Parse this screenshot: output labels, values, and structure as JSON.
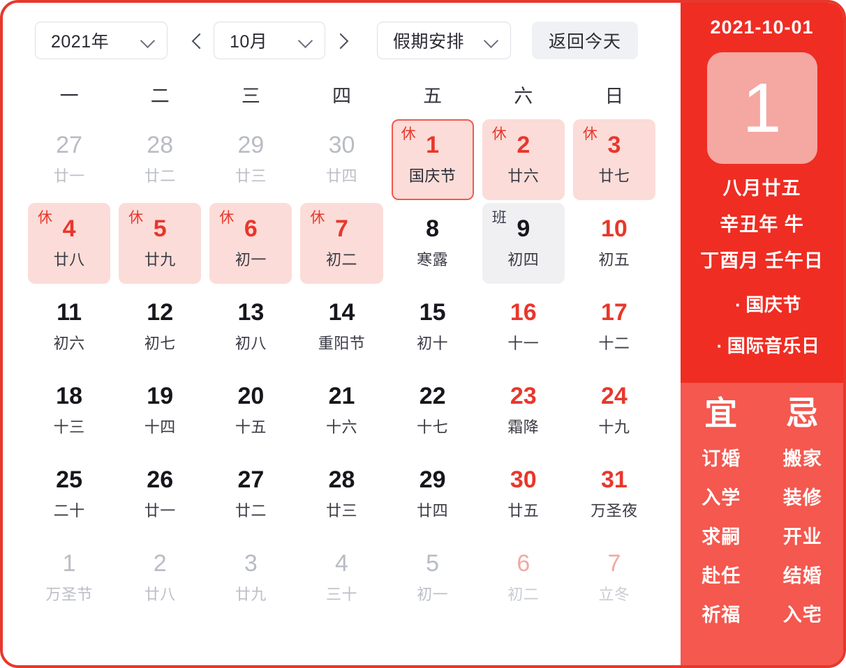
{
  "toolbar": {
    "year": "2021年",
    "month": "10月",
    "holiday_filter": "假期安排",
    "today_label": "返回今天",
    "prev_icon": "chevron-left-icon",
    "next_icon": "chevron-right-icon"
  },
  "weekdays": [
    "一",
    "二",
    "三",
    "四",
    "五",
    "六",
    "日"
  ],
  "days": [
    {
      "num": "27",
      "lunar": "廿一",
      "state": "out"
    },
    {
      "num": "28",
      "lunar": "廿二",
      "state": "out"
    },
    {
      "num": "29",
      "lunar": "廿三",
      "state": "out"
    },
    {
      "num": "30",
      "lunar": "廿四",
      "state": "out"
    },
    {
      "num": "1",
      "lunar": "国庆节",
      "state": "rest selected",
      "badge": "休"
    },
    {
      "num": "2",
      "lunar": "廿六",
      "state": "rest",
      "badge": "休"
    },
    {
      "num": "3",
      "lunar": "廿七",
      "state": "rest",
      "badge": "休"
    },
    {
      "num": "4",
      "lunar": "廿八",
      "state": "rest",
      "badge": "休"
    },
    {
      "num": "5",
      "lunar": "廿九",
      "state": "rest",
      "badge": "休"
    },
    {
      "num": "6",
      "lunar": "初一",
      "state": "rest",
      "badge": "休"
    },
    {
      "num": "7",
      "lunar": "初二",
      "state": "rest",
      "badge": "休"
    },
    {
      "num": "8",
      "lunar": "寒露",
      "state": "normal"
    },
    {
      "num": "9",
      "lunar": "初四",
      "state": "work",
      "badge": "班"
    },
    {
      "num": "10",
      "lunar": "初五",
      "state": "weekend"
    },
    {
      "num": "11",
      "lunar": "初六",
      "state": "normal"
    },
    {
      "num": "12",
      "lunar": "初七",
      "state": "normal"
    },
    {
      "num": "13",
      "lunar": "初八",
      "state": "normal"
    },
    {
      "num": "14",
      "lunar": "重阳节",
      "state": "normal"
    },
    {
      "num": "15",
      "lunar": "初十",
      "state": "normal"
    },
    {
      "num": "16",
      "lunar": "十一",
      "state": "weekend"
    },
    {
      "num": "17",
      "lunar": "十二",
      "state": "weekend"
    },
    {
      "num": "18",
      "lunar": "十三",
      "state": "normal"
    },
    {
      "num": "19",
      "lunar": "十四",
      "state": "normal"
    },
    {
      "num": "20",
      "lunar": "十五",
      "state": "normal"
    },
    {
      "num": "21",
      "lunar": "十六",
      "state": "normal"
    },
    {
      "num": "22",
      "lunar": "十七",
      "state": "normal"
    },
    {
      "num": "23",
      "lunar": "霜降",
      "state": "weekend"
    },
    {
      "num": "24",
      "lunar": "十九",
      "state": "weekend"
    },
    {
      "num": "25",
      "lunar": "二十",
      "state": "normal"
    },
    {
      "num": "26",
      "lunar": "廿一",
      "state": "normal"
    },
    {
      "num": "27",
      "lunar": "廿二",
      "state": "normal"
    },
    {
      "num": "28",
      "lunar": "廿三",
      "state": "normal"
    },
    {
      "num": "29",
      "lunar": "廿四",
      "state": "normal"
    },
    {
      "num": "30",
      "lunar": "廿五",
      "state": "weekend"
    },
    {
      "num": "31",
      "lunar": "万圣夜",
      "state": "weekend"
    },
    {
      "num": "1",
      "lunar": "万圣节",
      "state": "out"
    },
    {
      "num": "2",
      "lunar": "廿八",
      "state": "out"
    },
    {
      "num": "3",
      "lunar": "廿九",
      "state": "out"
    },
    {
      "num": "4",
      "lunar": "三十",
      "state": "out"
    },
    {
      "num": "5",
      "lunar": "初一",
      "state": "out"
    },
    {
      "num": "6",
      "lunar": "初二",
      "state": "out weekend"
    },
    {
      "num": "7",
      "lunar": "立冬",
      "state": "out weekend"
    }
  ],
  "detail": {
    "date": "2021-10-01",
    "day_number": "1",
    "lunar_date": "八月廿五",
    "ganzhi_year": "辛丑年 牛",
    "ganzhi_month_day": "丁酉月 壬午日",
    "festivals": [
      "国庆节",
      "国际音乐日"
    ],
    "suitable_title": "宜",
    "suitable": [
      "订婚",
      "入学",
      "求嗣",
      "赴任",
      "祈福"
    ],
    "avoid_title": "忌",
    "avoid": [
      "搬家",
      "装修",
      "开业",
      "结婚",
      "入宅"
    ]
  },
  "colors": {
    "brand_red": "#e8372c",
    "panel_red": "#ef2d23",
    "panel_red_light": "#f4584f",
    "rest_bg": "#fbdcd8",
    "work_bg": "#f0f0f2"
  }
}
